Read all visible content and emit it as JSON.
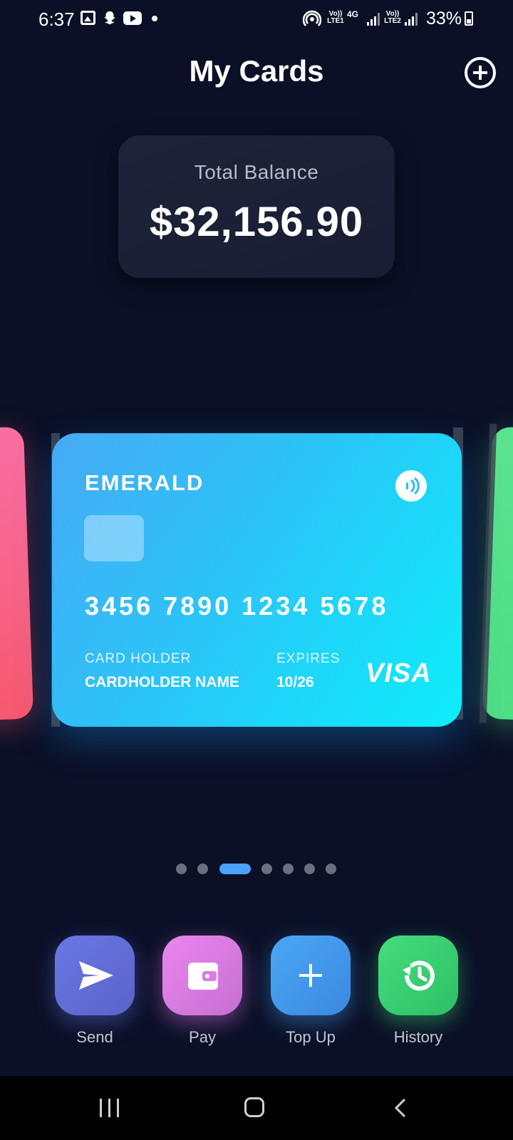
{
  "status_bar": {
    "time": "6:37",
    "network_1": "Vo)) LTE1",
    "network_type": "4G",
    "network_2": "Vo)) LTE2",
    "battery": "33%"
  },
  "header": {
    "title": "My Cards"
  },
  "balance": {
    "label": "Total Balance",
    "value": "$32,156.90"
  },
  "card": {
    "brand": "EMERALD",
    "number": "3456 7890 1234 5678",
    "holder_caption": "CARD HOLDER",
    "holder_name": "CARDHOLDER NAME",
    "expires_caption": "EXPIRES",
    "expires_value": "10/26",
    "network": "VISA"
  },
  "carousel": {
    "page_count": 7,
    "active_index": 2
  },
  "actions": [
    {
      "label": "Send",
      "icon": "send-icon",
      "color": "#6a78e5"
    },
    {
      "label": "Pay",
      "icon": "wallet-icon",
      "color": "#ea86ef"
    },
    {
      "label": "Top Up",
      "icon": "plus-icon",
      "color": "#4aa8f5"
    },
    {
      "label": "History",
      "icon": "history-icon",
      "color": "#44dd7e"
    }
  ],
  "colors": {
    "background": "#0b1027",
    "accent": "#4aa3ff"
  }
}
